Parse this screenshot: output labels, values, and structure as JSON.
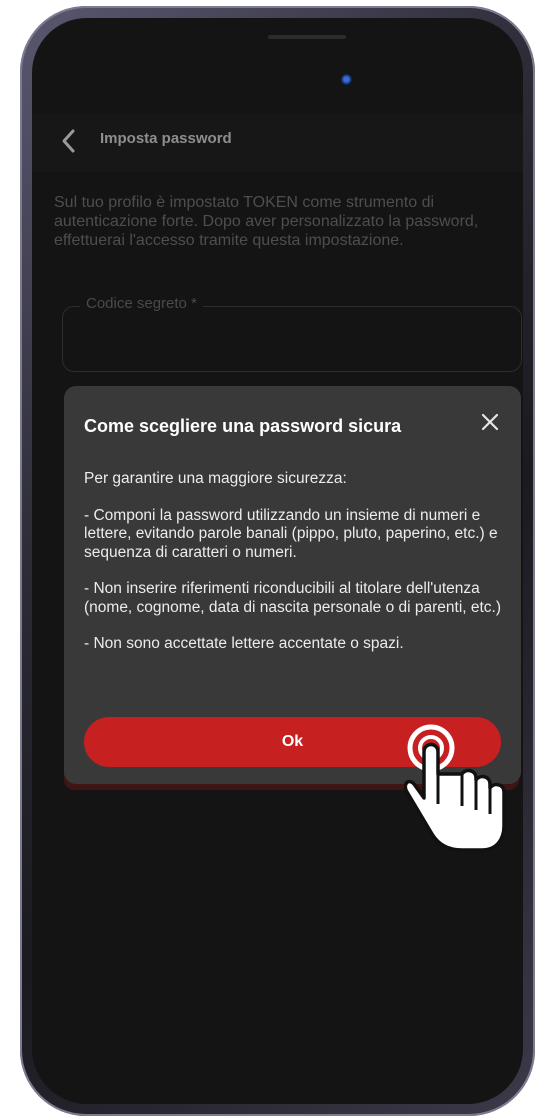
{
  "header": {
    "back_icon": "chevron-left-icon",
    "title": "Imposta password"
  },
  "intro_text": "Sul tuo profilo è impostato TOKEN come strumento di autenticazione forte. Dopo aver personalizzato la password, effettuerai l'accesso tramite questa impostazione.",
  "secret_field": {
    "label": "Codice segreto *",
    "value": ""
  },
  "dialog": {
    "title": "Come scegliere una password sicura",
    "close_icon": "close-icon",
    "paragraphs": [
      "Per garantire una maggiore sicurezza:",
      "- Componi la password utilizzando un insieme di numeri e lettere, evitando parole banali (pippo, pluto, paperino, etc.) e sequenza di caratteri o numeri.",
      "- Non inserire riferimenti riconducibili al titolare dell'utenza (nome, cognome, data di nascita personale o di parenti, etc.)",
      "- Non sono accettate lettere accentate o spazi."
    ],
    "ok_label": "Ok"
  },
  "tap_indicator_icon": "pointing-hand-icon",
  "colors": {
    "accent_red": "#c62020",
    "dialog_bg": "#393939",
    "screen_bg": "#141414"
  }
}
